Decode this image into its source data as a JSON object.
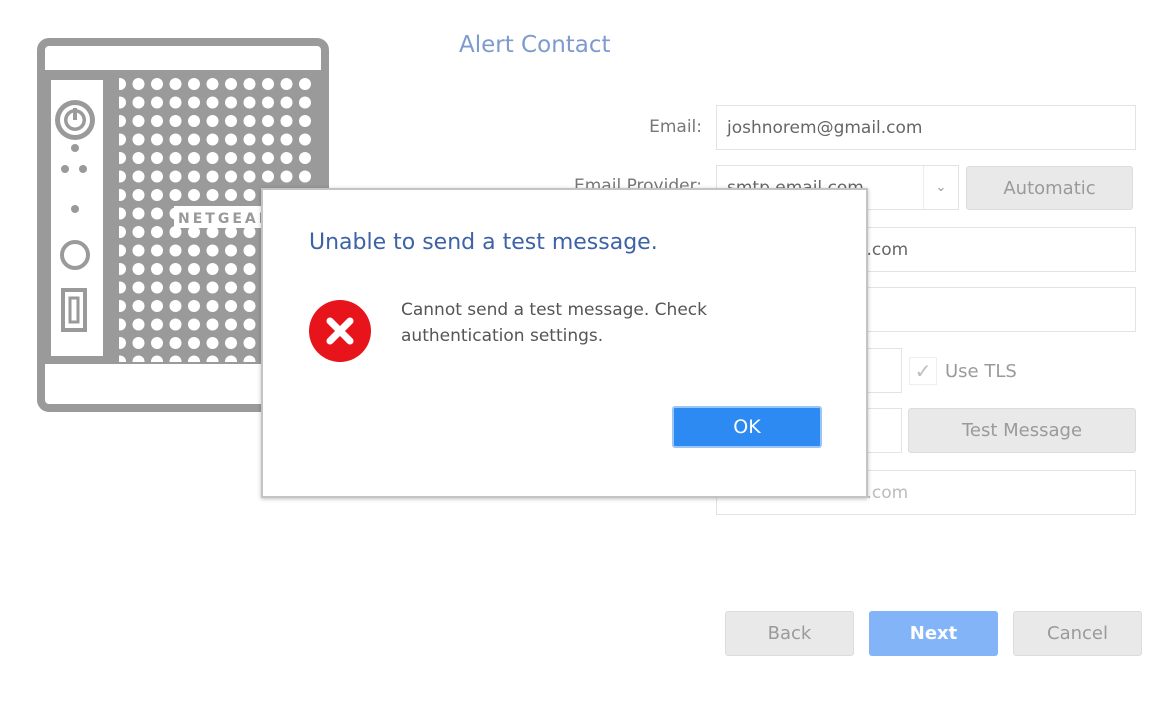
{
  "page": {
    "title": "Alert Contact",
    "brand": "NETGEAR"
  },
  "form": {
    "email": {
      "label": "Email:",
      "value": "joshnorem@gmail.com"
    },
    "email_provider": {
      "label": "Email Provider:",
      "value": "smtp.email.com",
      "auto_button": "Automatic"
    },
    "username": {
      "value_partial": "il.com"
    },
    "password": {
      "value": ""
    },
    "port": {
      "value": ""
    },
    "use_tls": {
      "label": "Use TLS",
      "checked": true
    },
    "test_message_button": "Test Message",
    "alert_email": {
      "value_partial": "il.com"
    }
  },
  "footer": {
    "back": "Back",
    "next": "Next",
    "cancel": "Cancel"
  },
  "dialog": {
    "title": "Unable to send a test message.",
    "icon": "error-icon",
    "message": "Cannot send a test message. Check authentication settings.",
    "ok": "OK"
  }
}
